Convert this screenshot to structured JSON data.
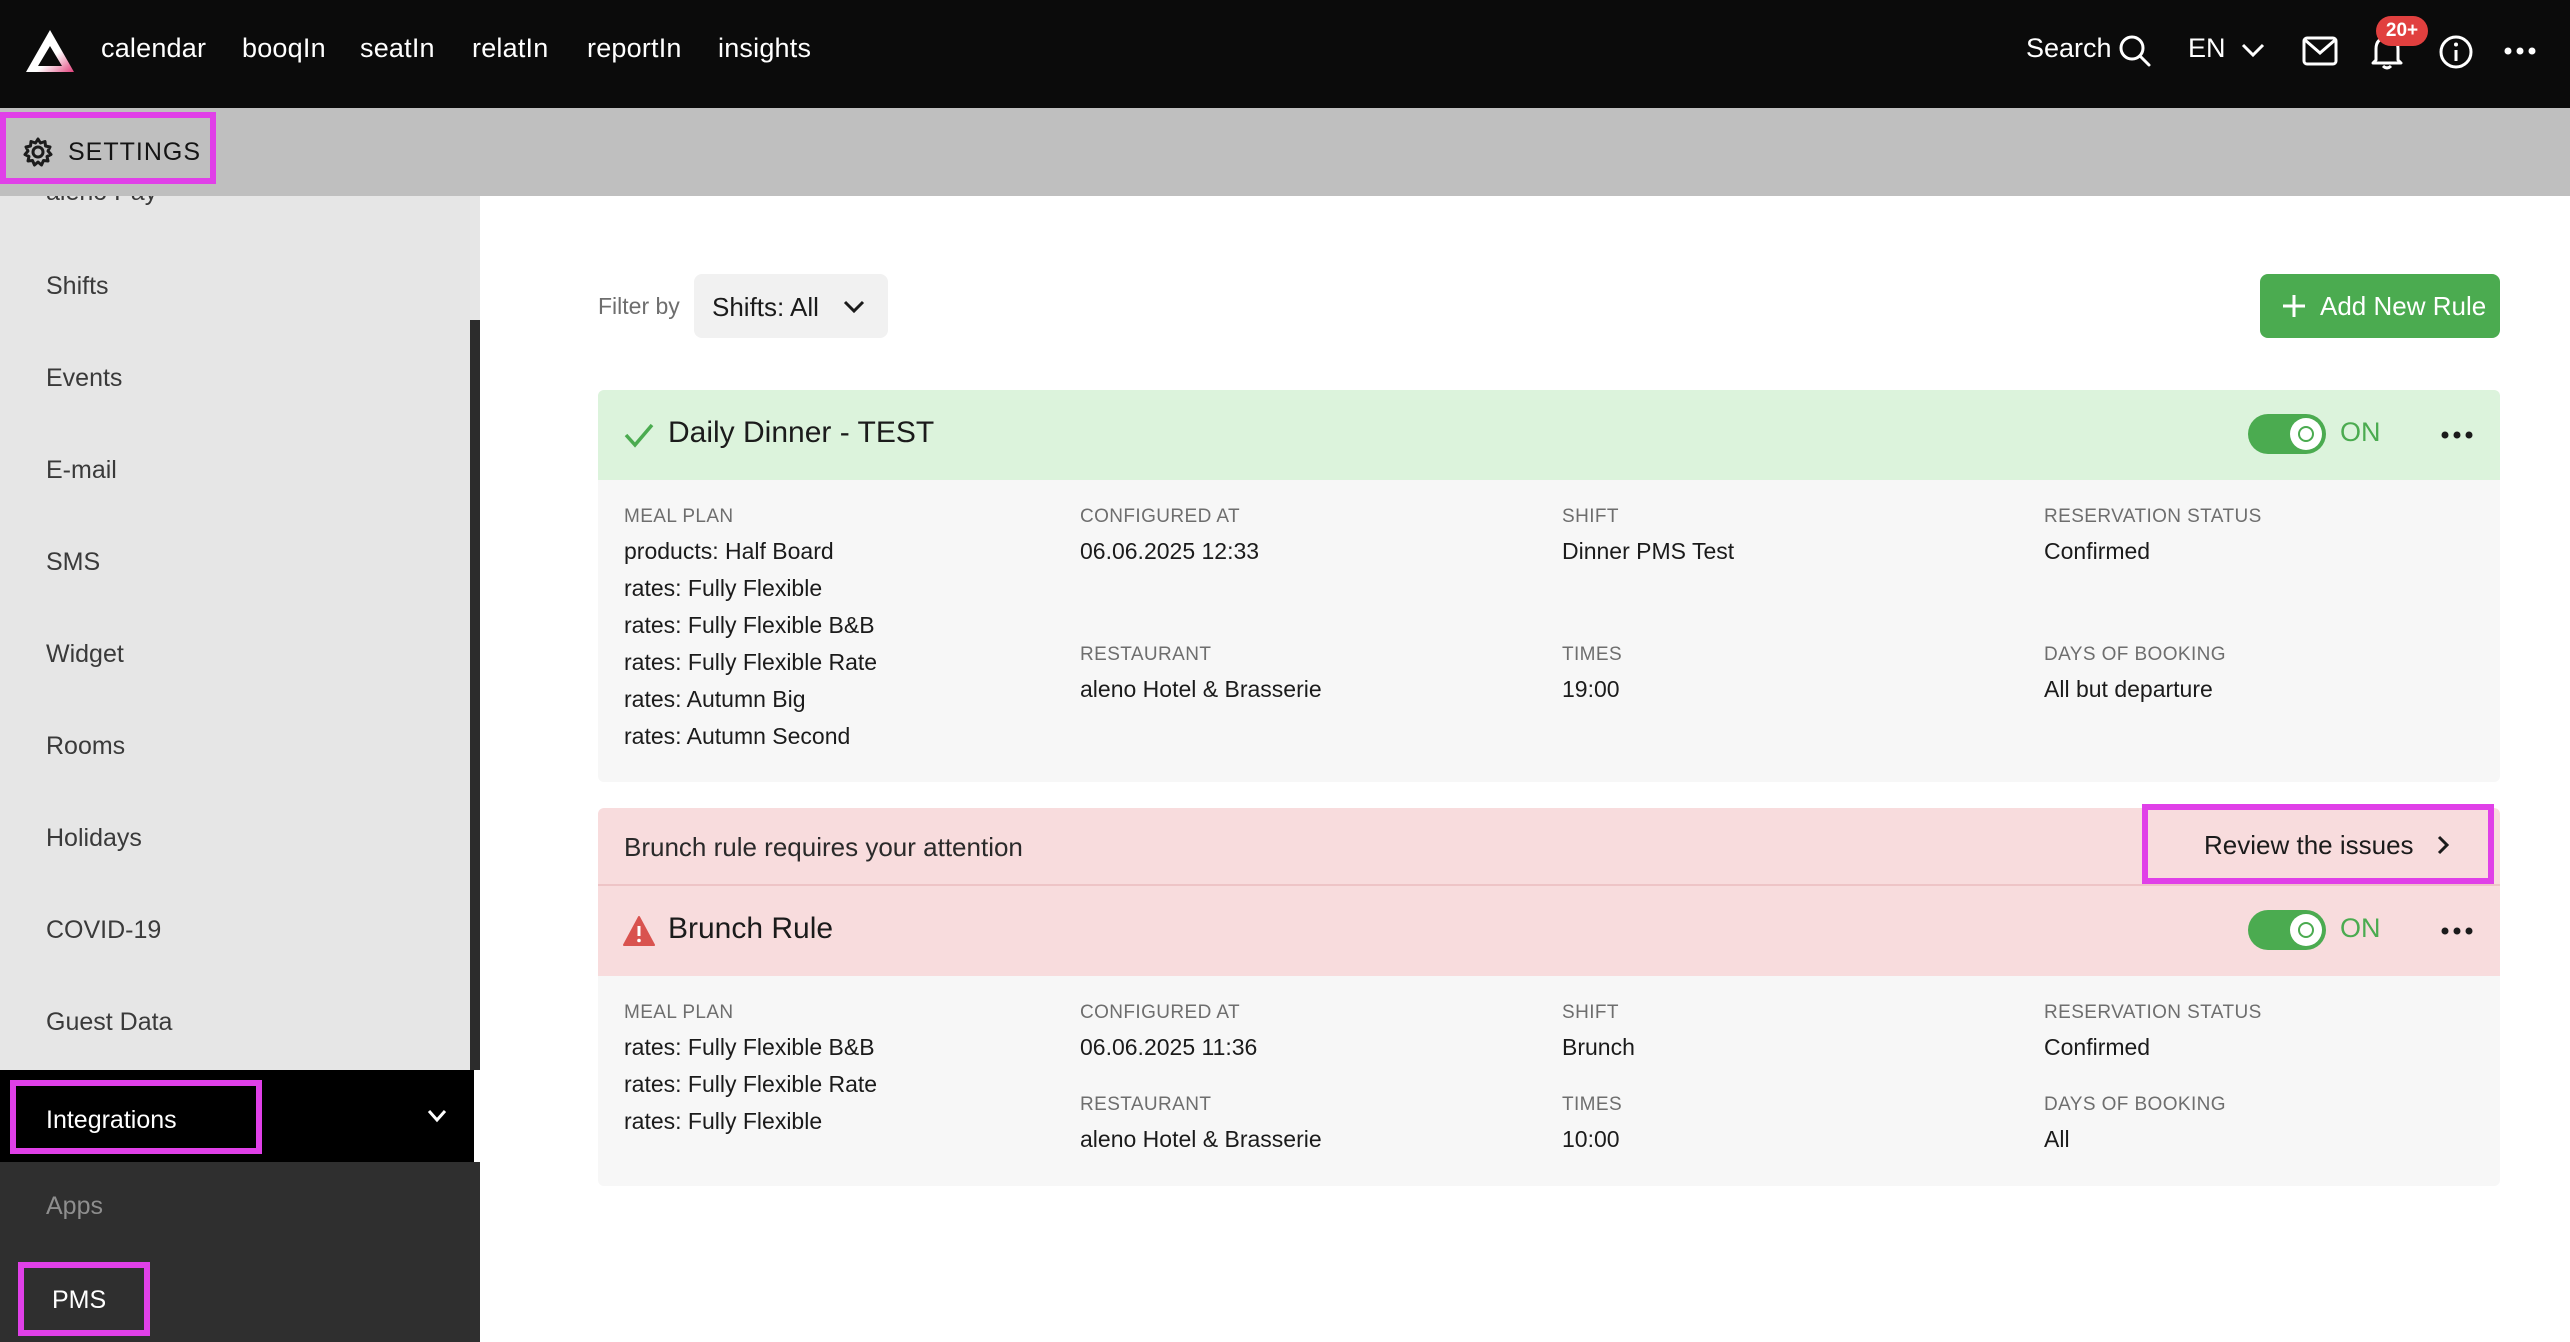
{
  "topbar": {
    "nav": [
      "calendar",
      "booqIn",
      "seatIn",
      "relatIn",
      "reportIn",
      "insights"
    ],
    "search_label": "Search",
    "language": "EN",
    "notifications_badge": "20+"
  },
  "settings": {
    "label": "SETTINGS"
  },
  "sidebar": {
    "partial_item": "aleno Pay",
    "items": [
      "Shifts",
      "Events",
      "E-mail",
      "SMS",
      "Widget",
      "Rooms",
      "Holidays",
      "COVID-19",
      "Guest Data"
    ],
    "section": "Integrations",
    "subitems": [
      "Apps",
      "PMS"
    ]
  },
  "filter": {
    "label": "Filter by",
    "value": "Shifts: All"
  },
  "add_button": {
    "label": "Add New Rule"
  },
  "labels": {
    "meal_plan": "MEAL PLAN",
    "configured_at": "CONFIGURED AT",
    "shift": "SHIFT",
    "reservation_status": "RESERVATION STATUS",
    "restaurant": "RESTAURANT",
    "times": "TIMES",
    "days_of_booking": "DAYS OF BOOKING"
  },
  "rules": [
    {
      "title": "Daily Dinner - TEST",
      "toggle": "ON",
      "meal_plan": [
        "products: Half Board",
        "rates: Fully Flexible",
        "rates: Fully Flexible B&B",
        "rates: Fully Flexible Rate",
        "rates: Autumn Big",
        "rates: Autumn Second"
      ],
      "configured_at": "06.06.2025 12:33",
      "shift": "Dinner PMS Test",
      "reservation_status": "Confirmed",
      "restaurant": "aleno Hotel & Brasserie",
      "times": "19:00",
      "days_of_booking": "All but departure"
    },
    {
      "title": "Brunch Rule",
      "toggle": "ON",
      "meal_plan": [
        "rates: Fully Flexible B&B",
        "rates: Fully Flexible Rate",
        "rates: Fully Flexible"
      ],
      "configured_at": "06.06.2025 11:36",
      "shift": "Brunch",
      "reservation_status": "Confirmed",
      "restaurant": "aleno Hotel & Brasserie",
      "times": "10:00",
      "days_of_booking": "All"
    }
  ],
  "attention": {
    "text": "Brunch rule requires your attention",
    "button": "Review the issues"
  },
  "colors": {
    "accent_green": "#4bab50",
    "success_bg": "#dcf3dc",
    "warning_bg": "#f8dcdd",
    "highlight": "#e040e8",
    "alert_red": "#e1403f"
  }
}
